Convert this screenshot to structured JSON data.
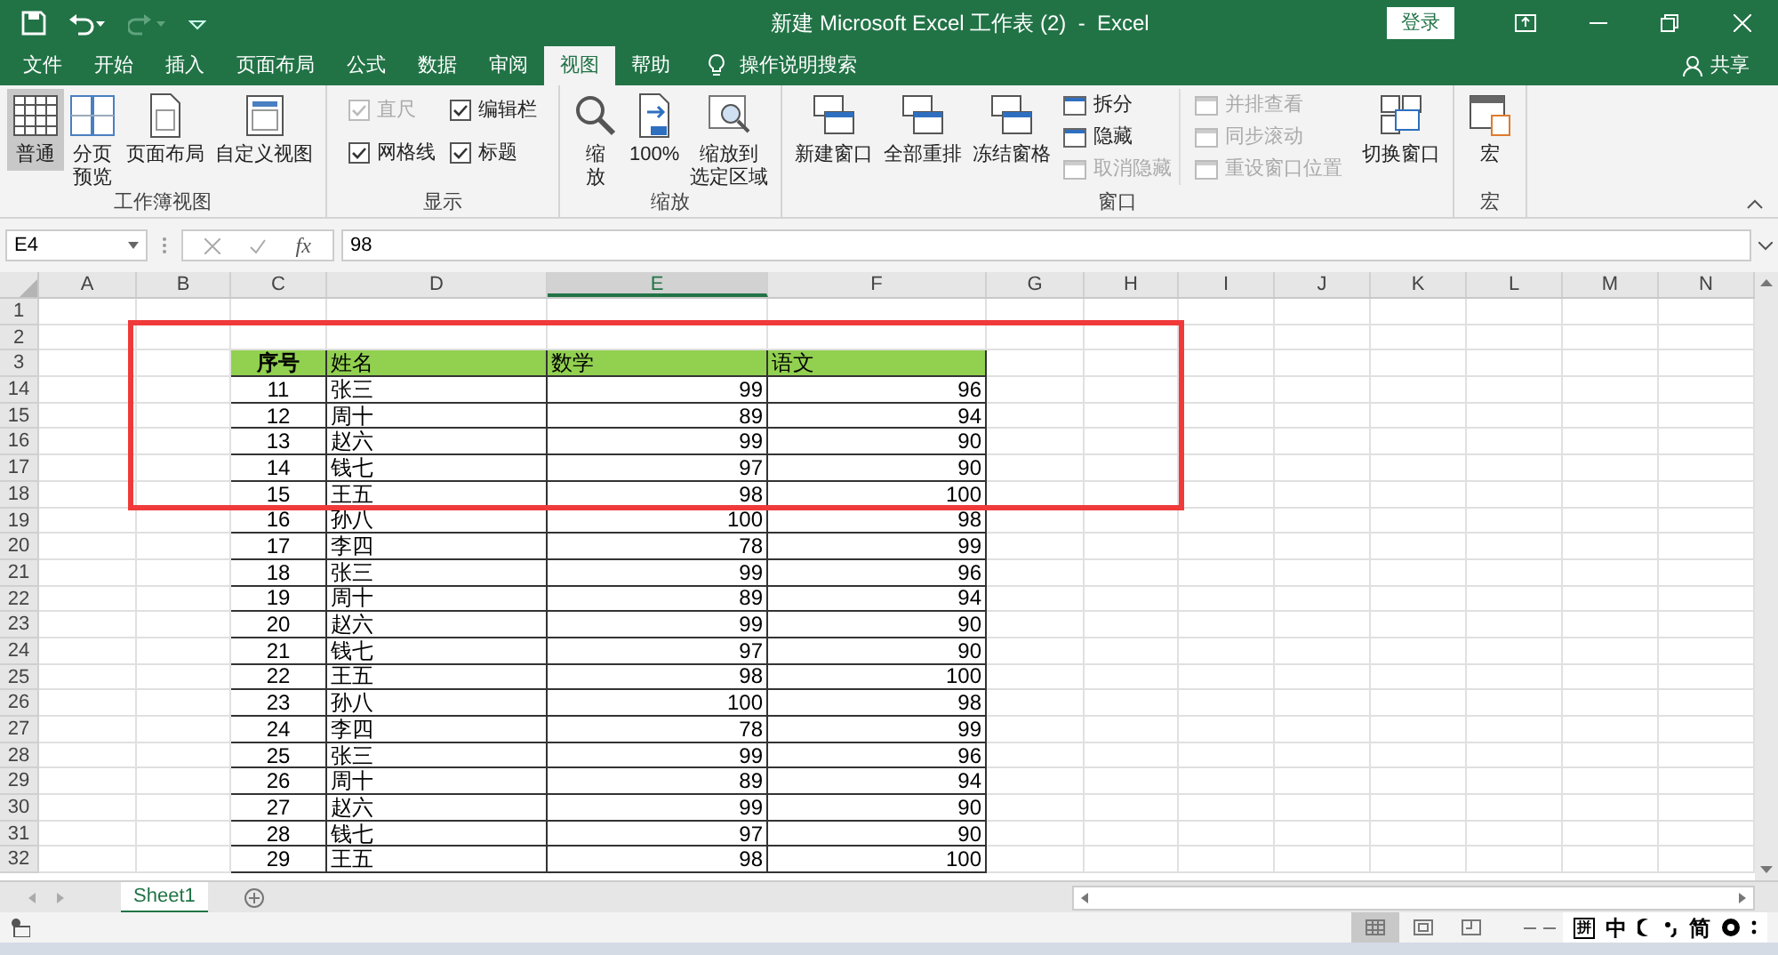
{
  "window": {
    "title": "新建 Microsoft Excel 工作表 (2)  -  Excel",
    "sign_in": "登录"
  },
  "tabs": [
    {
      "label": "文件",
      "selected": false
    },
    {
      "label": "开始",
      "selected": false
    },
    {
      "label": "插入",
      "selected": false
    },
    {
      "label": "页面布局",
      "selected": false
    },
    {
      "label": "公式",
      "selected": false
    },
    {
      "label": "数据",
      "selected": false
    },
    {
      "label": "审阅",
      "selected": false
    },
    {
      "label": "视图",
      "selected": true
    },
    {
      "label": "帮助",
      "selected": false
    }
  ],
  "tell_me": "操作说明搜索",
  "share": "共享",
  "ribbon": {
    "workbook_views": {
      "title": "工作簿视图",
      "items": [
        {
          "lines": [
            "普通"
          ],
          "selected": true
        },
        {
          "lines": [
            "分页",
            "预览"
          ],
          "selected": false
        },
        {
          "lines": [
            "页面布局"
          ],
          "selected": false
        },
        {
          "lines": [
            "自定义视图"
          ],
          "selected": false
        }
      ]
    },
    "show": {
      "title": "显示",
      "items": [
        {
          "label": "直尺",
          "checked": true,
          "disabled": true
        },
        {
          "label": "编辑栏",
          "checked": true,
          "disabled": false
        },
        {
          "label": "网格线",
          "checked": true,
          "disabled": false
        },
        {
          "label": "标题",
          "checked": true,
          "disabled": false
        }
      ]
    },
    "zoom": {
      "title": "缩放",
      "items": [
        {
          "lines": [
            "缩",
            "放"
          ]
        },
        {
          "lines": [
            "100%"
          ]
        },
        {
          "lines": [
            "缩放到",
            "选定区域"
          ]
        }
      ]
    },
    "window": {
      "title": "窗口",
      "big": [
        "新建窗口",
        "全部重排",
        "冻结窗格"
      ],
      "small": [
        {
          "label": "拆分",
          "disabled": false
        },
        {
          "label": "隐藏",
          "disabled": false
        },
        {
          "label": "取消隐藏",
          "disabled": true
        },
        {
          "label": "并排查看",
          "disabled": true
        },
        {
          "label": "同步滚动",
          "disabled": true
        },
        {
          "label": "重设窗口位置",
          "disabled": true
        }
      ],
      "switch": "切换窗口"
    },
    "macros": {
      "title": "宏",
      "item": "宏"
    }
  },
  "formula_bar": {
    "name_box": "E4",
    "fx": "fx",
    "value": "98"
  },
  "sheet": {
    "columns": [
      {
        "label": "A",
        "selected": false
      },
      {
        "label": "B",
        "selected": false
      },
      {
        "label": "C",
        "selected": false
      },
      {
        "label": "D",
        "selected": false
      },
      {
        "label": "E",
        "selected": true
      },
      {
        "label": "F",
        "selected": false
      },
      {
        "label": "G",
        "selected": false
      },
      {
        "label": "H",
        "selected": false
      },
      {
        "label": "I",
        "selected": false
      },
      {
        "label": "J",
        "selected": false
      },
      {
        "label": "K",
        "selected": false
      },
      {
        "label": "L",
        "selected": false
      },
      {
        "label": "M",
        "selected": false
      },
      {
        "label": "N",
        "selected": false
      }
    ],
    "rows": [
      {
        "number": "1",
        "kind": "blank"
      },
      {
        "number": "2",
        "kind": "blank"
      },
      {
        "number": "3",
        "kind": "header",
        "cells": [
          "序号",
          "姓名",
          "数学",
          "语文"
        ]
      },
      {
        "number": "14",
        "kind": "data",
        "cells": [
          "11",
          "张三",
          "99",
          "96"
        ]
      },
      {
        "number": "15",
        "kind": "data",
        "cells": [
          "12",
          "周十",
          "89",
          "94"
        ]
      },
      {
        "number": "16",
        "kind": "data",
        "cells": [
          "13",
          "赵六",
          "99",
          "90"
        ]
      },
      {
        "number": "17",
        "kind": "data",
        "cells": [
          "14",
          "钱七",
          "97",
          "90"
        ]
      },
      {
        "number": "18",
        "kind": "data",
        "cells": [
          "15",
          "王五",
          "98",
          "100"
        ]
      },
      {
        "number": "19",
        "kind": "data",
        "cells": [
          "16",
          "孙八",
          "100",
          "98"
        ]
      },
      {
        "number": "20",
        "kind": "data",
        "cells": [
          "17",
          "李四",
          "78",
          "99"
        ]
      },
      {
        "number": "21",
        "kind": "data",
        "cells": [
          "18",
          "张三",
          "99",
          "96"
        ]
      },
      {
        "number": "22",
        "kind": "data",
        "cells": [
          "19",
          "周十",
          "89",
          "94"
        ]
      },
      {
        "number": "23",
        "kind": "data",
        "cells": [
          "20",
          "赵六",
          "99",
          "90"
        ]
      },
      {
        "number": "24",
        "kind": "data",
        "cells": [
          "21",
          "钱七",
          "97",
          "90"
        ]
      },
      {
        "number": "25",
        "kind": "data",
        "cells": [
          "22",
          "王五",
          "98",
          "100"
        ]
      },
      {
        "number": "26",
        "kind": "data",
        "cells": [
          "23",
          "孙八",
          "100",
          "98"
        ]
      },
      {
        "number": "27",
        "kind": "data",
        "cells": [
          "24",
          "李四",
          "78",
          "99"
        ]
      },
      {
        "number": "28",
        "kind": "data",
        "cells": [
          "25",
          "张三",
          "99",
          "96"
        ]
      },
      {
        "number": "29",
        "kind": "data",
        "cells": [
          "26",
          "周十",
          "89",
          "94"
        ]
      },
      {
        "number": "30",
        "kind": "data",
        "cells": [
          "27",
          "赵六",
          "99",
          "90"
        ]
      },
      {
        "number": "31",
        "kind": "data",
        "cells": [
          "28",
          "钱七",
          "97",
          "90"
        ]
      },
      {
        "number": "32",
        "kind": "data",
        "cells": [
          "29",
          "王五",
          "98",
          "100"
        ]
      }
    ]
  },
  "sheet_tabs": [
    {
      "label": "Sheet1",
      "selected": true
    }
  ],
  "status_bar": {
    "views": [
      {
        "selected": true
      },
      {
        "selected": false
      },
      {
        "selected": false
      }
    ],
    "ime": [
      "拼",
      "中",
      "简"
    ]
  }
}
